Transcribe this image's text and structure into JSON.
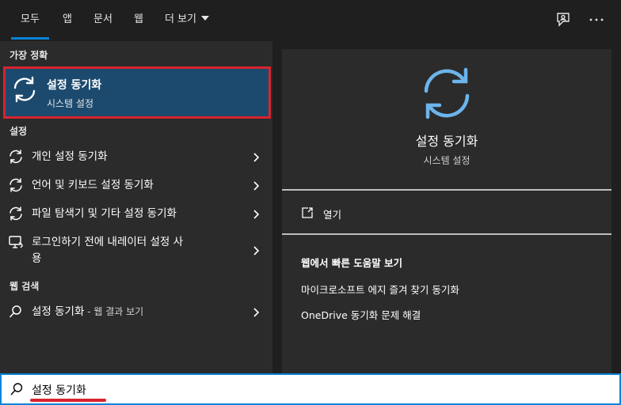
{
  "tabs": [
    {
      "label": "모두",
      "active": true
    },
    {
      "label": "앱"
    },
    {
      "label": "문서"
    },
    {
      "label": "웹"
    },
    {
      "label": "더 보기"
    }
  ],
  "top_icons": [
    "feedback-icon",
    "more-options-icon"
  ],
  "best_match": {
    "section_label": "가장 정확",
    "title": "설정 동기화",
    "subtitle": "시스템 설정",
    "icon": "sync-icon"
  },
  "settings": {
    "section_label": "설정",
    "items": [
      {
        "label": "개인 설정 동기화",
        "icon": "sync-icon"
      },
      {
        "label": "언어 및 키보드 설정 동기화",
        "icon": "sync-icon"
      },
      {
        "label": "파일 탐색기 및 기타 설정 동기화",
        "icon": "sync-icon"
      },
      {
        "label_line1": "로그인하기 전에 내레이터 설정 사",
        "label_line2": "용",
        "icon": "narrator-icon"
      }
    ]
  },
  "web_search": {
    "section_label": "웹 검색",
    "item_label": "설정 동기화",
    "item_suffix": " - 웹 결과 보기",
    "icon": "search-icon"
  },
  "preview": {
    "title": "설정 동기화",
    "subtitle": "시스템 설정",
    "open_label": "열기",
    "web_help_title": "웹에서 빠른 도움말 보기",
    "links": [
      "마이크로소프트 에지 즐겨 찾기 동기화",
      "OneDrive 동기화 문제 해결"
    ]
  },
  "search": {
    "value": "설정 동기화"
  },
  "colors": {
    "accent": "#0a84d6",
    "selection": "#1c4a6e",
    "highlight_border": "#d9232e",
    "sync_icon_blue": "#6cb4ec"
  }
}
